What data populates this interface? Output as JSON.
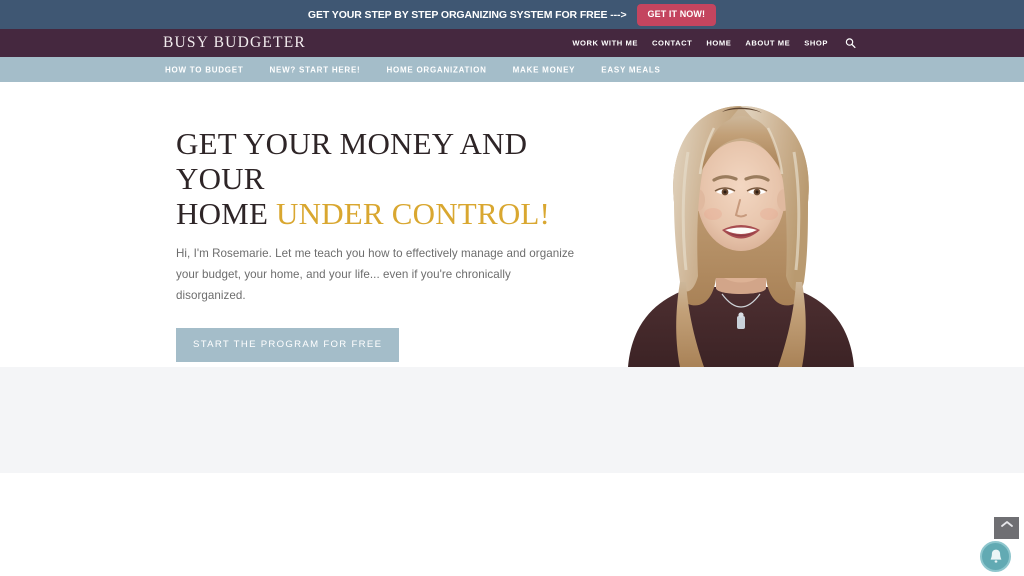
{
  "promo": {
    "text": "GET YOUR STEP BY STEP ORGANIZING SYSTEM FOR FREE --->",
    "button_label": "GET IT NOW!",
    "bar_color": "#3f5773",
    "button_color": "#c4455f"
  },
  "header": {
    "logo": "BUSY  BUDGETER",
    "bar_color": "#45283f",
    "nav": [
      {
        "label": "WORK WITH ME"
      },
      {
        "label": "CONTACT"
      },
      {
        "label": "HOME"
      },
      {
        "label": "ABOUT ME"
      },
      {
        "label": "SHOP"
      }
    ],
    "search_icon": "search-icon"
  },
  "subnav": {
    "bar_color": "#a4bdc9",
    "items": [
      {
        "label": "HOW TO BUDGET"
      },
      {
        "label": "NEW? START HERE!"
      },
      {
        "label": "HOME ORGANIZATION"
      },
      {
        "label": "MAKE MONEY"
      },
      {
        "label": "EASY MEALS"
      }
    ]
  },
  "hero": {
    "title_line1": "GET YOUR MONEY AND YOUR",
    "title_line2_plain": "HOME ",
    "title_line2_accent": "UNDER CONTROL!",
    "accent_color": "#d9a730",
    "title_color": "#2e2527",
    "subtext": "Hi, I'm Rosemarie. Let me teach you how to effectively manage and organize your budget, your home, and your life... even if you're chronically disorganized.",
    "cta_label": "START THE PROGRAM FOR FREE",
    "cta_color": "#a4bdc9",
    "photo_alt": "portrait-photo-rosemarie"
  },
  "sections": {
    "gray_band_color": "#f4f5f7",
    "white_band_color": "#ffffff"
  },
  "widgets": {
    "scroll_top_icon": "chevron-up-icon",
    "notification_icon": "bell-icon",
    "notification_color": "#62aab3"
  }
}
